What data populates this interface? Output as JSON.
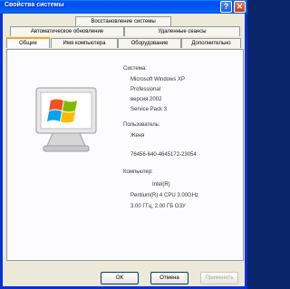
{
  "window": {
    "title": "Свойства системы",
    "help_glyph": "?",
    "close_glyph": "✕"
  },
  "tabs": {
    "row1": [
      "Восстановление системы"
    ],
    "row2": [
      "Автоматическое обновление",
      "Удаленные сеансы"
    ],
    "row3": [
      "Общие",
      "Имя компьютера",
      "Оборудование",
      "Дополнительно"
    ]
  },
  "general": {
    "system_heading": "Система:",
    "os_name": "Microsoft Windows XP",
    "os_edition": "Professional",
    "os_version": "версия 2002",
    "service_pack": "Service Pack 3",
    "registered_heading": "Пользователь:",
    "user_name": "Женя",
    "product_id": "76456-640-4645172-23054",
    "computer_heading": "Компьютер:",
    "cpu_vendor": "Intel(R)",
    "cpu_model": "Pentium(R) 4 CPU 3.00GHz",
    "cpu_ram": "3.00 ГГц, 2.00 ГБ ОЗУ"
  },
  "buttons": {
    "ok": "ОК",
    "cancel": "Отмена",
    "apply": "Применить"
  },
  "colors": {
    "title_bar": "#0054e3",
    "logo_red": "#f25022",
    "logo_green": "#7fba00",
    "logo_blue": "#00a4ef",
    "logo_yellow": "#ffb900"
  }
}
